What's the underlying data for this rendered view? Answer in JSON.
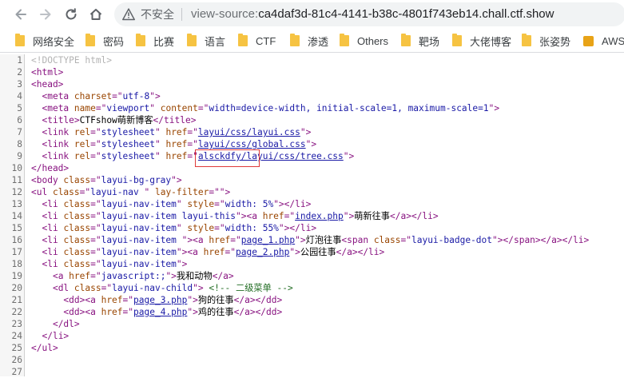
{
  "toolbar": {
    "security_label": "不安全",
    "url_scheme": "view-source:",
    "url_host": "ca4daf3d-81c4-4141-b38c-4801f743eb14.chall.ctf.show"
  },
  "bookmarks": [
    {
      "label": "网络安全",
      "icon": "folder-icon"
    },
    {
      "label": "密码",
      "icon": "folder-icon"
    },
    {
      "label": "比赛",
      "icon": "folder-icon"
    },
    {
      "label": "语言",
      "icon": "folder-icon"
    },
    {
      "label": "CTF",
      "icon": "folder-icon"
    },
    {
      "label": "渗透",
      "icon": "folder-icon"
    },
    {
      "label": "Others",
      "icon": "folder-icon"
    },
    {
      "label": "靶场",
      "icon": "folder-icon"
    },
    {
      "label": "大佬博客",
      "icon": "folder-icon"
    },
    {
      "label": "张姿势",
      "icon": "folder-icon"
    },
    {
      "label": "AWS",
      "icon": "aws-icon"
    }
  ],
  "source": {
    "line_numbers": [
      "1",
      "2",
      "3",
      "4",
      "5",
      "6",
      "7",
      "8",
      "9",
      "10",
      "11",
      "12",
      "13",
      "14",
      "15",
      "16",
      "17",
      "18",
      "19",
      "20",
      "21",
      "22",
      "23",
      "24",
      "25",
      "26",
      "27"
    ],
    "lines": [
      [
        {
          "c": "doctype",
          "t": "<!DOCTYPE html>"
        }
      ],
      [
        {
          "c": "tag",
          "t": "<html>"
        }
      ],
      [
        {
          "c": "tag",
          "t": "<head>"
        }
      ],
      [
        {
          "c": "",
          "t": "  "
        },
        {
          "c": "tag",
          "t": "<meta "
        },
        {
          "c": "attr",
          "t": "charset"
        },
        {
          "c": "tag",
          "t": "=\""
        },
        {
          "c": "val",
          "t": "utf-8"
        },
        {
          "c": "tag",
          "t": "\">"
        }
      ],
      [
        {
          "c": "",
          "t": "  "
        },
        {
          "c": "tag",
          "t": "<meta "
        },
        {
          "c": "attr",
          "t": "name"
        },
        {
          "c": "tag",
          "t": "=\""
        },
        {
          "c": "val",
          "t": "viewport"
        },
        {
          "c": "tag",
          "t": "\" "
        },
        {
          "c": "attr",
          "t": "content"
        },
        {
          "c": "tag",
          "t": "=\""
        },
        {
          "c": "val",
          "t": "width=device-width, initial-scale=1, maximum-scale=1"
        },
        {
          "c": "tag",
          "t": "\">"
        }
      ],
      [
        {
          "c": "",
          "t": "  "
        },
        {
          "c": "tag",
          "t": "<title>"
        },
        {
          "c": "",
          "t": "CTFshow萌新博客"
        },
        {
          "c": "tag",
          "t": "</title>"
        }
      ],
      [
        {
          "c": "",
          "t": "  "
        },
        {
          "c": "tag",
          "t": "<link "
        },
        {
          "c": "attr",
          "t": "rel"
        },
        {
          "c": "tag",
          "t": "=\""
        },
        {
          "c": "val",
          "t": "stylesheet"
        },
        {
          "c": "tag",
          "t": "\" "
        },
        {
          "c": "attr",
          "t": "href"
        },
        {
          "c": "tag",
          "t": "=\""
        },
        {
          "c": "lnk",
          "t": "layui/css/layui.css"
        },
        {
          "c": "tag",
          "t": "\">"
        }
      ],
      [
        {
          "c": "",
          "t": "  "
        },
        {
          "c": "tag",
          "t": "<link "
        },
        {
          "c": "attr",
          "t": "rel"
        },
        {
          "c": "tag",
          "t": "=\""
        },
        {
          "c": "val",
          "t": "stylesheet"
        },
        {
          "c": "tag",
          "t": "\" "
        },
        {
          "c": "attr",
          "t": "href"
        },
        {
          "c": "tag",
          "t": "=\""
        },
        {
          "c": "lnk",
          "t": "layui/css/global.css"
        },
        {
          "c": "tag",
          "t": "\">"
        }
      ],
      [
        {
          "c": "",
          "t": "  "
        },
        {
          "c": "tag",
          "t": "<link "
        },
        {
          "c": "attr",
          "t": "rel"
        },
        {
          "c": "tag",
          "t": "=\""
        },
        {
          "c": "val",
          "t": "stylesheet"
        },
        {
          "c": "tag",
          "t": "\" "
        },
        {
          "c": "attr",
          "t": "href"
        },
        {
          "c": "tag",
          "t": "=\""
        },
        {
          "c": "lnk",
          "t": "alsckdfy/layui/css/tree.css"
        },
        {
          "c": "tag",
          "t": "\">"
        }
      ],
      [
        {
          "c": "tag",
          "t": "</head>"
        }
      ],
      [
        {
          "c": "tag",
          "t": "<body "
        },
        {
          "c": "attr",
          "t": "class"
        },
        {
          "c": "tag",
          "t": "=\""
        },
        {
          "c": "val",
          "t": "layui-bg-gray"
        },
        {
          "c": "tag",
          "t": "\">"
        }
      ],
      [
        {
          "c": "tag",
          "t": "<ul "
        },
        {
          "c": "attr",
          "t": "class"
        },
        {
          "c": "tag",
          "t": "=\""
        },
        {
          "c": "val",
          "t": "layui-nav "
        },
        {
          "c": "tag",
          "t": "\" "
        },
        {
          "c": "attr",
          "t": "lay-filter"
        },
        {
          "c": "tag",
          "t": "=\"\">"
        }
      ],
      [
        {
          "c": "",
          "t": "  "
        },
        {
          "c": "tag",
          "t": "<li "
        },
        {
          "c": "attr",
          "t": "class"
        },
        {
          "c": "tag",
          "t": "=\""
        },
        {
          "c": "val",
          "t": "layui-nav-item"
        },
        {
          "c": "tag",
          "t": "\" "
        },
        {
          "c": "attr",
          "t": "style"
        },
        {
          "c": "tag",
          "t": "=\""
        },
        {
          "c": "val",
          "t": "width: 5%"
        },
        {
          "c": "tag",
          "t": "\"></li>"
        }
      ],
      [
        {
          "c": "",
          "t": "  "
        },
        {
          "c": "tag",
          "t": "<li "
        },
        {
          "c": "attr",
          "t": "class"
        },
        {
          "c": "tag",
          "t": "=\""
        },
        {
          "c": "val",
          "t": "layui-nav-item layui-this"
        },
        {
          "c": "tag",
          "t": "\"><a "
        },
        {
          "c": "attr",
          "t": "href"
        },
        {
          "c": "tag",
          "t": "=\""
        },
        {
          "c": "lnk",
          "t": "index.php"
        },
        {
          "c": "tag",
          "t": "\">"
        },
        {
          "c": "",
          "t": "萌新往事"
        },
        {
          "c": "tag",
          "t": "</a></li>"
        }
      ],
      [
        {
          "c": "",
          "t": "  "
        },
        {
          "c": "tag",
          "t": "<li "
        },
        {
          "c": "attr",
          "t": "class"
        },
        {
          "c": "tag",
          "t": "=\""
        },
        {
          "c": "val",
          "t": "layui-nav-item"
        },
        {
          "c": "tag",
          "t": "\" "
        },
        {
          "c": "attr",
          "t": "style"
        },
        {
          "c": "tag",
          "t": "=\""
        },
        {
          "c": "val",
          "t": "width: 55%"
        },
        {
          "c": "tag",
          "t": "\"></li>"
        }
      ],
      [
        {
          "c": "",
          "t": "  "
        },
        {
          "c": "tag",
          "t": "<li "
        },
        {
          "c": "attr",
          "t": "class"
        },
        {
          "c": "tag",
          "t": "=\""
        },
        {
          "c": "val",
          "t": "layui-nav-item "
        },
        {
          "c": "tag",
          "t": "\"><a "
        },
        {
          "c": "attr",
          "t": "href"
        },
        {
          "c": "tag",
          "t": "=\""
        },
        {
          "c": "lnk",
          "t": "page_1.php"
        },
        {
          "c": "tag",
          "t": "\">"
        },
        {
          "c": "",
          "t": "灯泡往事"
        },
        {
          "c": "tag",
          "t": "<span "
        },
        {
          "c": "attr",
          "t": "class"
        },
        {
          "c": "tag",
          "t": "=\""
        },
        {
          "c": "val",
          "t": "layui-badge-dot"
        },
        {
          "c": "tag",
          "t": "\"></span></a></li>"
        }
      ],
      [
        {
          "c": "",
          "t": "  "
        },
        {
          "c": "tag",
          "t": "<li "
        },
        {
          "c": "attr",
          "t": "class"
        },
        {
          "c": "tag",
          "t": "=\""
        },
        {
          "c": "val",
          "t": "layui-nav-item"
        },
        {
          "c": "tag",
          "t": "\"><a "
        },
        {
          "c": "attr",
          "t": "href"
        },
        {
          "c": "tag",
          "t": "=\""
        },
        {
          "c": "lnk",
          "t": "page_2.php"
        },
        {
          "c": "tag",
          "t": "\">"
        },
        {
          "c": "",
          "t": "公园往事"
        },
        {
          "c": "tag",
          "t": "</a></li>"
        }
      ],
      [
        {
          "c": "",
          "t": "  "
        },
        {
          "c": "tag",
          "t": "<li "
        },
        {
          "c": "attr",
          "t": "class"
        },
        {
          "c": "tag",
          "t": "=\""
        },
        {
          "c": "val",
          "t": "layui-nav-item"
        },
        {
          "c": "tag",
          "t": "\">"
        }
      ],
      [
        {
          "c": "",
          "t": "    "
        },
        {
          "c": "tag",
          "t": "<a "
        },
        {
          "c": "attr",
          "t": "href"
        },
        {
          "c": "tag",
          "t": "=\""
        },
        {
          "c": "val",
          "t": "javascript:;"
        },
        {
          "c": "tag",
          "t": "\">"
        },
        {
          "c": "",
          "t": "我和动物"
        },
        {
          "c": "tag",
          "t": "</a>"
        }
      ],
      [
        {
          "c": "",
          "t": "    "
        },
        {
          "c": "tag",
          "t": "<dl "
        },
        {
          "c": "attr",
          "t": "class"
        },
        {
          "c": "tag",
          "t": "=\""
        },
        {
          "c": "val",
          "t": "layui-nav-child"
        },
        {
          "c": "tag",
          "t": "\"> "
        },
        {
          "c": "comment",
          "t": "<!-- 二级菜单 -->"
        }
      ],
      [
        {
          "c": "",
          "t": "      "
        },
        {
          "c": "tag",
          "t": "<dd><a "
        },
        {
          "c": "attr",
          "t": "href"
        },
        {
          "c": "tag",
          "t": "=\""
        },
        {
          "c": "lnk",
          "t": "page_3.php"
        },
        {
          "c": "tag",
          "t": "\">"
        },
        {
          "c": "",
          "t": "狗的往事"
        },
        {
          "c": "tag",
          "t": "</a></dd>"
        }
      ],
      [
        {
          "c": "",
          "t": "      "
        },
        {
          "c": "tag",
          "t": "<dd><a "
        },
        {
          "c": "attr",
          "t": "href"
        },
        {
          "c": "tag",
          "t": "=\""
        },
        {
          "c": "lnk",
          "t": "page_4.php"
        },
        {
          "c": "tag",
          "t": "\">"
        },
        {
          "c": "",
          "t": "鸡的往事"
        },
        {
          "c": "tag",
          "t": "</a></dd>"
        }
      ],
      [
        {
          "c": "",
          "t": "    "
        },
        {
          "c": "tag",
          "t": "</dl>"
        }
      ],
      [
        {
          "c": "",
          "t": "  "
        },
        {
          "c": "tag",
          "t": "</li>"
        }
      ],
      [
        {
          "c": "tag",
          "t": "</ul>"
        }
      ],
      [],
      []
    ]
  }
}
